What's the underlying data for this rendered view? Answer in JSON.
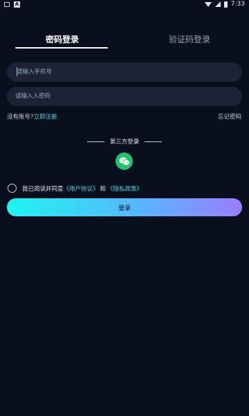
{
  "status_bar": {
    "time": "7:33"
  },
  "tabs": {
    "password_login": "密码登录",
    "code_login": "验证码登录"
  },
  "form": {
    "phone_placeholder": "请输入手机号",
    "password_placeholder": "请输入入密码"
  },
  "links": {
    "no_account": "没有账号?",
    "register": "立即注册",
    "forgot_password": "忘记密码"
  },
  "third_party": {
    "title": "第三方登录",
    "wechat_icon": "wechat-icon"
  },
  "agreement": {
    "text": "我已阅读并同意",
    "user_agreement": "《用户协议》",
    "and": "和",
    "privacy_policy": "《隐私政策》"
  },
  "login_button": "登录",
  "colors": {
    "background": "#0a0f1d",
    "accent": "#3fd7e6",
    "wechat": "#22c46a"
  }
}
